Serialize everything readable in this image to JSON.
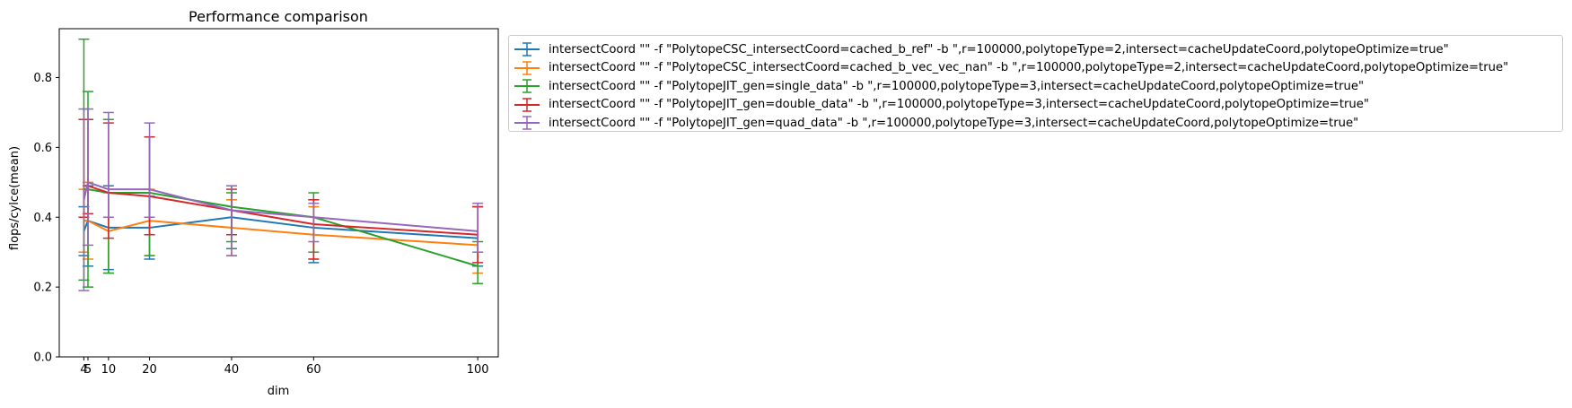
{
  "chart_data": {
    "type": "line",
    "title": "Performance comparison",
    "xlabel": "dim",
    "ylabel": "flops/cylce(mean)",
    "xlim": [
      -2,
      105
    ],
    "ylim": [
      0,
      0.94
    ],
    "xticks": [
      4,
      5,
      10,
      20,
      40,
      60,
      100
    ],
    "yticks": [
      0.0,
      0.2,
      0.4,
      0.6,
      0.8
    ],
    "ytick_labels": [
      "0.0",
      "0.2",
      "0.4",
      "0.6",
      "0.8"
    ],
    "grid": false,
    "legend_position": "outside-right",
    "error_bars": true,
    "x": [
      4,
      5,
      10,
      20,
      40,
      60,
      100
    ],
    "series": [
      {
        "name": "intersectCoord \"\" -f \"PolytopeCSC_intersectCoord=cached_b_ref\" -b \",r=100000,polytopeType=2,intersect=cacheUpdateCoord,polytopeOptimize=true\"",
        "color": "#1f77b4",
        "values": [
          0.36,
          0.39,
          0.37,
          0.37,
          0.4,
          0.37,
          0.34
        ],
        "err_low": [
          0.29,
          0.26,
          0.25,
          0.28,
          0.31,
          0.27,
          0.26
        ],
        "err_high": [
          0.43,
          0.49,
          0.49,
          0.46,
          0.49,
          0.45,
          0.43
        ]
      },
      {
        "name": "intersectCoord \"\" -f \"PolytopeCSC_intersectCoord=cached_b_vec_vec_nan\" -b \",r=100000,polytopeType=2,intersect=cacheUpdateCoord,polytopeOptimize=true\"",
        "color": "#ff7f0e",
        "values": [
          0.39,
          0.39,
          0.36,
          0.39,
          0.37,
          0.35,
          0.32
        ],
        "err_low": [
          0.3,
          0.28,
          0.24,
          0.29,
          0.29,
          0.28,
          0.24
        ],
        "err_high": [
          0.48,
          0.5,
          0.47,
          0.48,
          0.45,
          0.43,
          0.43
        ]
      },
      {
        "name": "intersectCoord \"\" -f \"PolytopeJIT_gen=single_data\" -b \",r=100000,polytopeType=3,intersect=cacheUpdateCoord,polytopeOptimize=true\"",
        "color": "#2ca02c",
        "values": [
          0.48,
          0.48,
          0.47,
          0.47,
          0.43,
          0.4,
          0.26
        ],
        "err_low": [
          0.22,
          0.2,
          0.24,
          0.29,
          0.33,
          0.3,
          0.21
        ],
        "err_high": [
          0.91,
          0.76,
          0.68,
          0.63,
          0.47,
          0.47,
          0.33
        ]
      },
      {
        "name": "intersectCoord \"\" -f \"PolytopeJIT_gen=double_data\" -b \",r=100000,polytopeType=3,intersect=cacheUpdateCoord,polytopeOptimize=true\"",
        "color": "#d62728",
        "values": [
          0.49,
          0.49,
          0.47,
          0.46,
          0.42,
          0.38,
          0.35
        ],
        "err_low": [
          0.4,
          0.41,
          0.34,
          0.35,
          0.35,
          0.28,
          0.27
        ],
        "err_high": [
          0.68,
          0.68,
          0.67,
          0.63,
          0.48,
          0.45,
          0.43
        ]
      },
      {
        "name": "intersectCoord \"\" -f \"PolytopeJIT_gen=quad_data\" -b \",r=100000,polytopeType=3,intersect=cacheUpdateCoord,polytopeOptimize=true\"",
        "color": "#9467bd",
        "values": [
          0.45,
          0.5,
          0.48,
          0.48,
          0.42,
          0.4,
          0.36
        ],
        "err_low": [
          0.19,
          0.32,
          0.4,
          0.4,
          0.29,
          0.33,
          0.3
        ],
        "err_high": [
          0.71,
          0.71,
          0.7,
          0.67,
          0.49,
          0.44,
          0.44
        ]
      }
    ]
  }
}
